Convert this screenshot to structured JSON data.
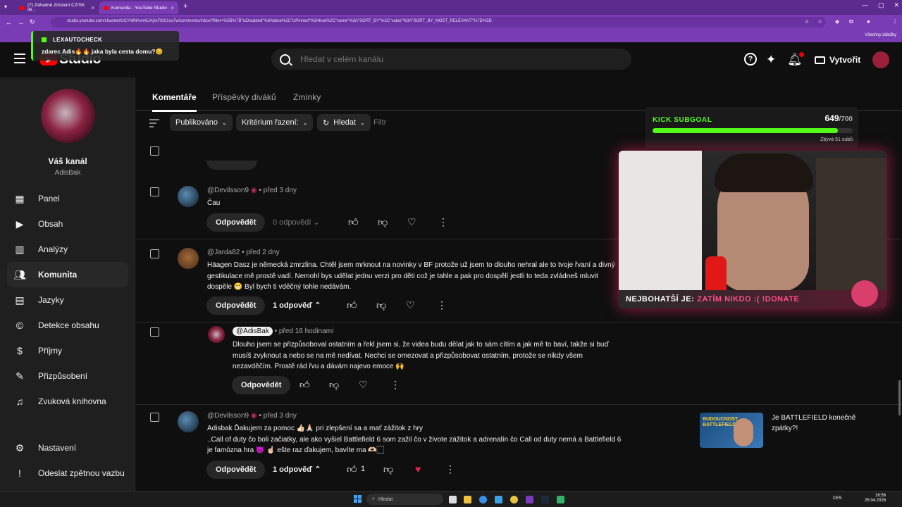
{
  "browser": {
    "tabs": [
      {
        "label": "(7) Záhadné Zmizení CZ/SK IR..."
      },
      {
        "label": "Komunita - YouTube Studio"
      }
    ],
    "url": "studio.youtube.com/channel/UCYMMAxm9JAylsF8tS1so7w/comments/inbox?filter=%5B%7B\"isDisabled\"%3Afalse%2C\"isPinned\"%3Atrue%2C\"name\"%3A\"SORT_BY\"%2C\"value\"%3A\"SORT_BY_MOST_RELEVANT\"%7D%5D",
    "bookmarks_label": "Všechny záložky"
  },
  "header": {
    "logo_text": "Studio",
    "search_placeholder": "Hledat v celém kanálu",
    "create_label": "Vytvořit"
  },
  "sidebar": {
    "channel_title": "Váš kanál",
    "channel_handle": "AdisBak",
    "items": [
      {
        "label": "Panel",
        "icon": "dashboard-icon"
      },
      {
        "label": "Obsah",
        "icon": "content-icon"
      },
      {
        "label": "Analýzy",
        "icon": "analytics-icon"
      },
      {
        "label": "Komunita",
        "icon": "community-icon",
        "active": true
      },
      {
        "label": "Jazyky",
        "icon": "subtitles-icon"
      },
      {
        "label": "Detekce obsahu",
        "icon": "copyright-icon"
      },
      {
        "label": "Příjmy",
        "icon": "earnings-icon"
      },
      {
        "label": "Přizpůsobení",
        "icon": "customization-icon"
      },
      {
        "label": "Zvuková knihovna",
        "icon": "audio-library-icon"
      }
    ],
    "bottom": [
      {
        "label": "Nastavení",
        "icon": "gear-icon"
      },
      {
        "label": "Odeslat zpětnou vazbu",
        "icon": "feedback-icon"
      }
    ]
  },
  "chat_overlay": {
    "user": "LEXAUTOCHECK",
    "message": "zdarec Adis🔥🔥 jaka byla cesta domu?😊"
  },
  "tabs": [
    {
      "label": "Komentáře",
      "active": true
    },
    {
      "label": "Příspěvky diváků"
    },
    {
      "label": "Zmínky"
    }
  ],
  "filters": {
    "published": "Publikováno",
    "sort": "Kritérium řazení:",
    "search": "Hledat",
    "filter_placeholder": "Filtr"
  },
  "comments": [
    {
      "author": "@Devilsson9",
      "time": "před 3 dny",
      "text": "Čau",
      "reply_button": "Odpovědět",
      "replies": "0 odpovědí"
    },
    {
      "author": "@Jarda82",
      "time": "před 2 dny",
      "text": "Häagen Dasz je německá zmrzlina. Chtěl jsem mrknout na novinky v BF protože už jsem to dlouho nehral ale to tvoje řvaní a divný gestikulace mě prostě vadí.  Nemohl bys udělat jednu verzi pro děti což je tahle a pak pro dospělí jestli to teda zvládneš mluvit dospěle 😬 Byl bych ti vděčný tohle nedávám.",
      "reply_button": "Odpovědět",
      "replies": "1 odpověď"
    },
    {
      "author": "@AdisBak",
      "time": "před 16 hodinami",
      "text": "Dlouho jsem se přizpůsoboval ostatním a řekl jsem si, že videa budu dělat jak to sám cítím a jak mě to baví, takže si buď musíš zvyknout a nebo se na mě nedívat. Nechci se omezovat a přizpůsobovat ostatním, protože se nikdy všem nezavděčím. Prostě rád řvu a dávám najevo emoce 🙌",
      "reply_button": "Odpovědět"
    },
    {
      "author": "@Devilsson9",
      "time": "před 3 dny",
      "text": "Adisbak Ďakujem za pomoc 👍🏻🙏🏻 pri zlepšení sa a mať zážitok z hry\n..Call of duty čo boli začiatky, ale ako vyšiel Battlefield 6 som zažil čo v živote zážitok a adrenalín čo Call od duty nemá a Battlefield 6 je famózna hra 😈 ☝🏻 ešte raz ďakujem, bavíte ma 🫶🏻🏻",
      "reply_button": "Odpovědět",
      "replies": "1 odpověď",
      "likes": "1",
      "video_thumb_text": "BUDOUCNOST BATTLEFIELDU",
      "video_title": "Je BATTLEFIELD konečně zpátky?!"
    }
  ],
  "stream": {
    "subgoal_title": "KICK SUBGOAL",
    "subgoal_count": "649",
    "subgoal_total": "/700",
    "subgoal_progress": 0.927,
    "subgoal_sub": "Zbývá 51 subů",
    "banner_a": "NEJBOHATŠÍ JE:",
    "banner_b": "ZATÍM NIKDO :( !DONATE"
  },
  "taskbar": {
    "search": "Hledat",
    "lang": "CES",
    "time": "16:56",
    "date": "25.04.2026"
  },
  "colors": {
    "accent": "#53fc18",
    "chrome": "#7a3cb4",
    "brand": "#ff0000"
  }
}
